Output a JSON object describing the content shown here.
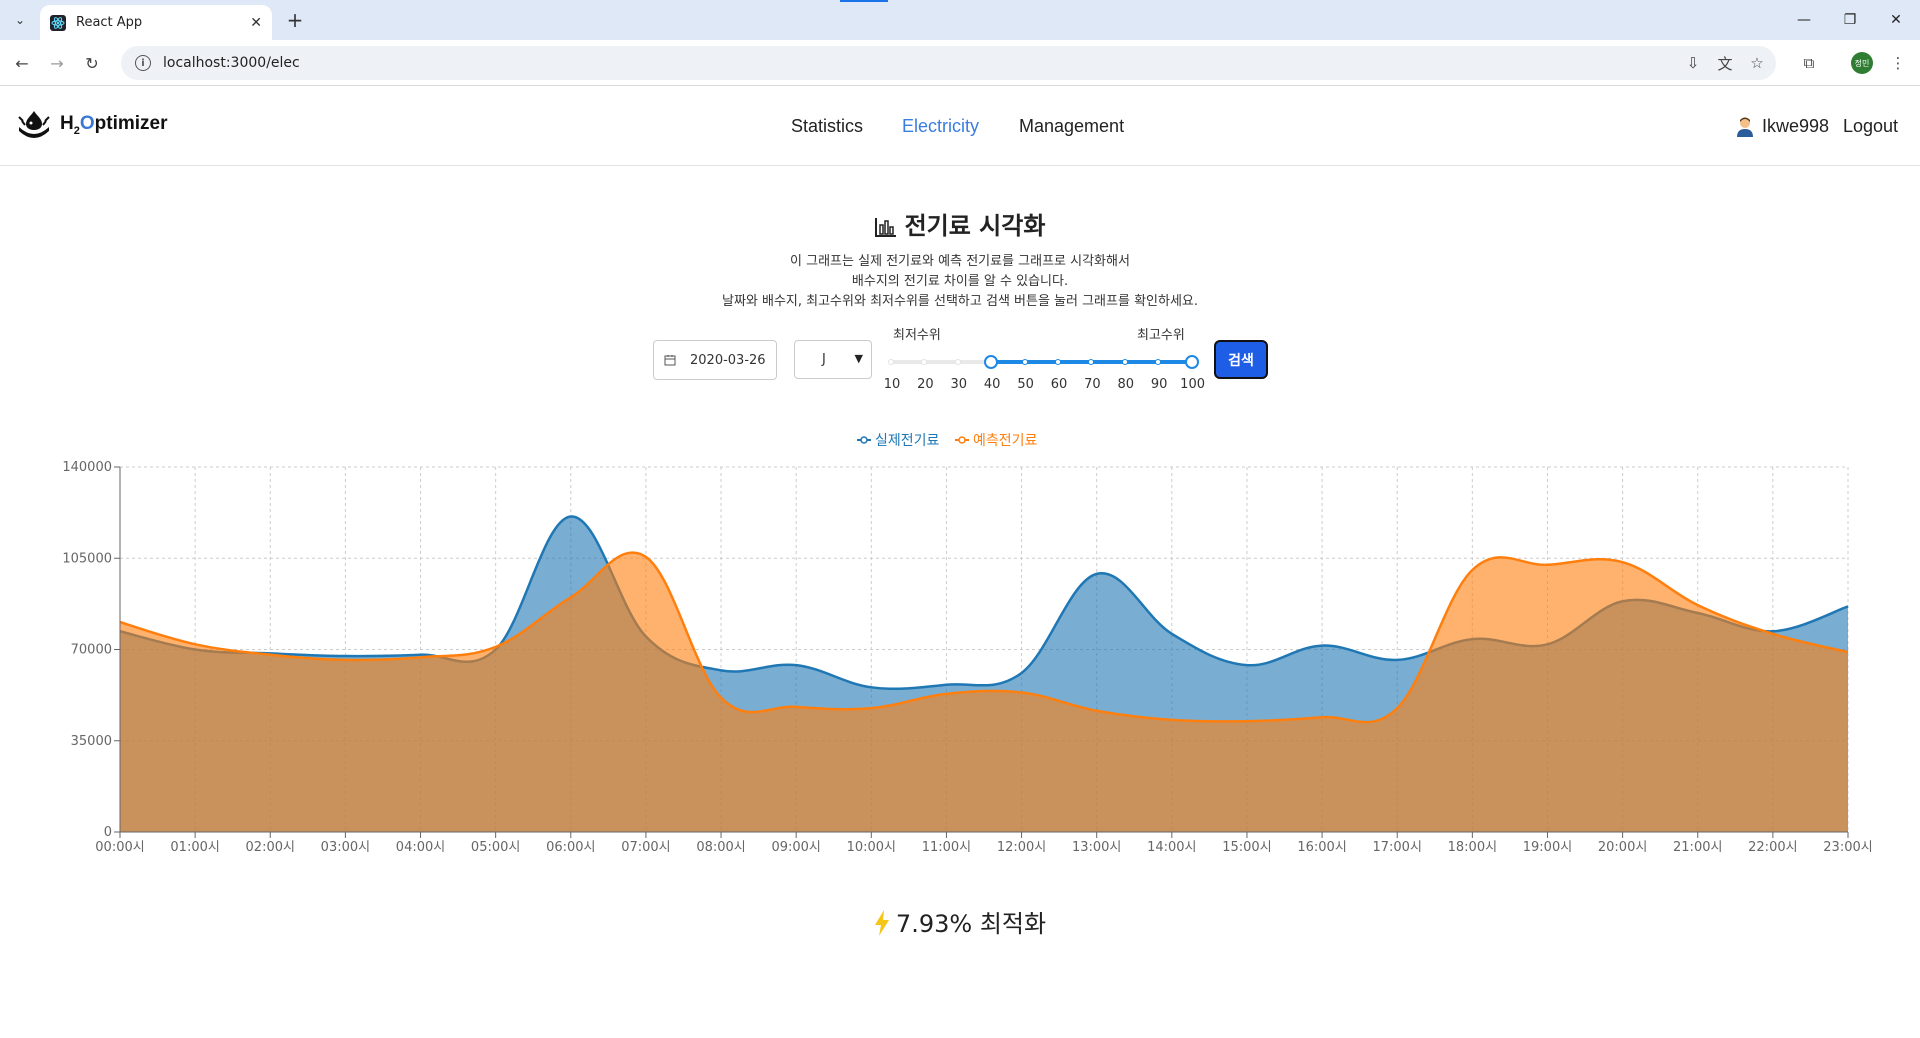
{
  "browser": {
    "tab_title": "React App",
    "url": "localhost:3000/elec",
    "profile_label": "정민"
  },
  "app": {
    "brand": {
      "h": "H",
      "sub": "2",
      "o": "O",
      "rest": "ptimizer"
    },
    "menu": [
      "Statistics",
      "Electricity",
      "Management"
    ],
    "active_menu": "Electricity",
    "username": "Ikwe998",
    "logout": "Logout"
  },
  "page": {
    "title": "전기료 시각화",
    "description": [
      "이 그래프는 실제 전기료와 예측 전기료를 그래프로 시각화해서",
      "배수지의 전기료 차이를 알 수 있습니다.",
      "날짜와 배수지, 최고수위와 최저수위를 선택하고 검색 버튼을 눌러 그래프를 확인하세요."
    ],
    "date_value": "2020-03-26",
    "reservoir_value": "J",
    "min_label": "최저수위",
    "max_label": "최고수위",
    "slider_marks": [
      "10",
      "20",
      "30",
      "40",
      "50",
      "60",
      "70",
      "80",
      "90",
      "100"
    ],
    "slider_min": 40,
    "slider_max": 100,
    "search_label": "검색",
    "optimize_value": "7.93%",
    "optimize_label": "최적화"
  },
  "colors": {
    "actual": "#1f77b4",
    "predicted": "#ff7f0e",
    "accent": "#3a7de0",
    "search_button": "#1e5ee6"
  },
  "chart_data": {
    "type": "area",
    "categories": [
      "00:00시",
      "01:00시",
      "02:00시",
      "03:00시",
      "04:00시",
      "05:00시",
      "06:00시",
      "07:00시",
      "08:00시",
      "09:00시",
      "10:00시",
      "11:00시",
      "12:00시",
      "13:00시",
      "14:00시",
      "15:00시",
      "16:00시",
      "17:00시",
      "18:00시",
      "19:00시",
      "20:00시",
      "21:00시",
      "22:00시",
      "23:00시"
    ],
    "series": [
      {
        "name": "실제전기료",
        "color": "#1f77b4",
        "values": [
          77000,
          70000,
          68500,
          67500,
          68000,
          70000,
          121000,
          75000,
          62000,
          64000,
          55500,
          56500,
          61000,
          99000,
          76000,
          64000,
          71500,
          66000,
          74000,
          72000,
          88500,
          84000,
          77000,
          86500
        ]
      },
      {
        "name": "예측전기료",
        "color": "#ff7f0e",
        "values": [
          80500,
          72000,
          68000,
          66000,
          67000,
          71000,
          90000,
          105500,
          51500,
          48000,
          47500,
          53000,
          53500,
          46500,
          43000,
          42500,
          44000,
          47500,
          100500,
          102500,
          103500,
          87000,
          76000,
          69000
        ]
      }
    ],
    "yticks": [
      0,
      35000,
      70000,
      105000,
      140000
    ],
    "ylim": [
      0,
      140000
    ],
    "legend": "top-center",
    "grid": true
  }
}
